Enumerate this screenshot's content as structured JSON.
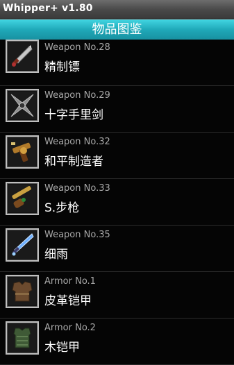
{
  "app": {
    "title": "Whipper+  v1.80"
  },
  "header": {
    "title": "物品图鉴"
  },
  "items": [
    {
      "number": "Weapon No.28",
      "name": "精制镖",
      "icon": "dagger-icon"
    },
    {
      "number": "Weapon No.29",
      "name": "十字手里剑",
      "icon": "shuriken-icon"
    },
    {
      "number": "Weapon No.32",
      "name": "和平制造者",
      "icon": "revolver-icon"
    },
    {
      "number": "Weapon No.33",
      "name": "S.步枪",
      "icon": "rifle-icon"
    },
    {
      "number": "Weapon No.35",
      "name": "细雨",
      "icon": "blue-blade-icon"
    },
    {
      "number": "Armor No.1",
      "name": "皮革铠甲",
      "icon": "leather-armor-icon"
    },
    {
      "number": "Armor No.2",
      "name": "木铠甲",
      "icon": "wood-armor-icon"
    }
  ]
}
